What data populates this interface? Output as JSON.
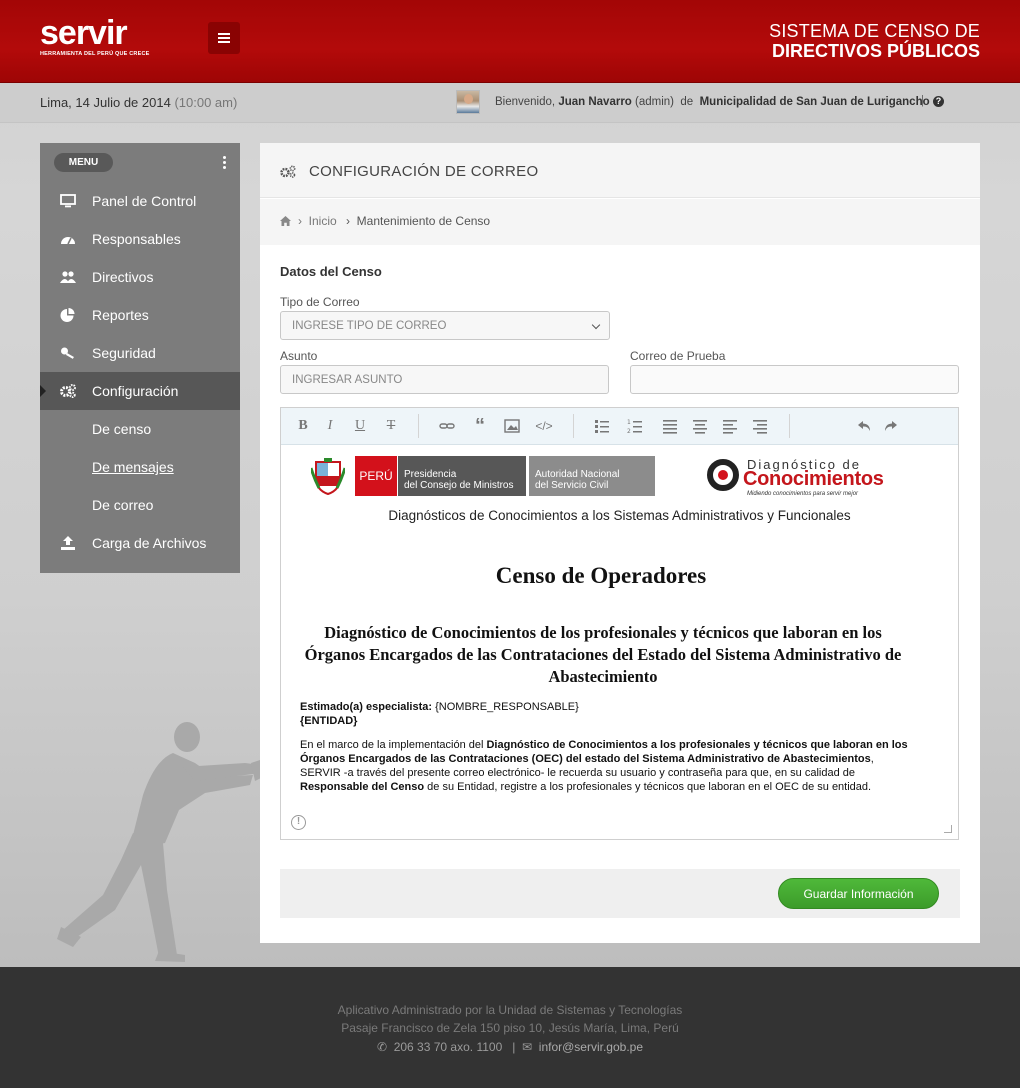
{
  "header": {
    "logo_text": "servir",
    "logo_tagline": "HERRAMIENTA DEL PERÚ QUE CRECE",
    "title_line1": "SISTEMA DE CENSO  DE",
    "title_line2": "DIRECTIVOS PÚBLICOS"
  },
  "infobar": {
    "date": "Lima, 14 Julio de 2014",
    "time": "(10:00 am)",
    "welcome_prefix": "Bienvenido,",
    "user_name": "Juan Navarro",
    "user_role": "(admin)",
    "of": "de",
    "institution": "Municipalidad de San Juan de Lurigancho",
    "separator": "|",
    "help": "?"
  },
  "sidebar": {
    "menu_label": "MENU",
    "items": [
      {
        "label": "Panel de Control",
        "icon": "monitor-icon"
      },
      {
        "label": "Responsables",
        "icon": "dashboard-icon"
      },
      {
        "label": "Directivos",
        "icon": "users-icon"
      },
      {
        "label": "Reportes",
        "icon": "pie-chart-icon"
      },
      {
        "label": "Seguridad",
        "icon": "key-icon"
      },
      {
        "label": "Configuración",
        "icon": "cogs-icon"
      }
    ],
    "subitems": [
      {
        "label": "De censo"
      },
      {
        "label": "De mensajes"
      },
      {
        "label": "De correo"
      }
    ],
    "upload": {
      "label": "Carga de Archivos",
      "icon": "upload-icon"
    }
  },
  "panel": {
    "title": "CONFIGURACIÓN DE CORREO",
    "breadcrumb": [
      "Inicio",
      "Mantenimiento de Censo"
    ],
    "section_title": "Datos del Censo",
    "tipo_label": "Tipo de Correo",
    "tipo_placeholder": "INGRESE TIPO DE CORREO",
    "asunto_label": "Asunto",
    "asunto_placeholder": "INGRESAR ASUNTO",
    "prueba_label": "Correo de Prueba",
    "prueba_value": "",
    "save_button": "Guardar Información"
  },
  "editor": {
    "toolbar": [
      "bold-icon",
      "italic-icon",
      "underline-icon",
      "strikethrough-icon",
      "link-icon",
      "quote-icon",
      "image-icon",
      "code-icon",
      "bullet-list-icon",
      "numbered-list-icon",
      "align-justify-icon",
      "align-center-icon",
      "align-left-icon",
      "align-right-icon",
      "undo-icon",
      "redo-icon"
    ],
    "logos": {
      "peru": "PERÚ",
      "pcm_line1": "Presidencia",
      "pcm_line2": "del Consejo de Ministros",
      "ansc_line1": "Autoridad Nacional",
      "ansc_line2": "del Servicio Civil",
      "diag_line1": "Diagnóstico de",
      "diag_line2": "Conocimientos",
      "diag_line3": "Midiendo conocimientos para servir mejor"
    },
    "subtitle": "Diagnósticos de Conocimientos a los Sistemas Administrativos y Funcionales",
    "title": "Censo de Operadores",
    "heading": "Diagnóstico de Conocimientos de los profesionales y técnicos que laboran en los Órganos Encargados de las Contrataciones del Estado del Sistema Administrativo de Abastecimiento",
    "greeting_label": "Estimado(a) especialista:",
    "greeting_var": "{NOMBRE_RESPONSABLE}",
    "entity_var": "{ENTIDAD}",
    "body_p1": "En el marco de la implementación del ",
    "body_b1": "Diagnóstico de Conocimientos a los profesionales y técnicos que laboran en los Órganos Encargados de las Contrataciones (OEC) del estado del Sistema Administrativo de Abastecimientos",
    "body_p2": ", SERVIR -a través del presente correo electrónico- le recuerda su usuario y contraseña para que, en su calidad de ",
    "body_b2": "Responsable del Censo",
    "body_p3": " de su Entidad, registre a los profesionales y técnicos que laboran en el OEC de su entidad."
  },
  "footer": {
    "line1": "Aplicativo Administrado por la Unidad de Sistemas y Tecnologías",
    "line2": "Pasaje Francisco de Zela 150 piso 10, Jesús María, Lima, Perú",
    "phone": "206 33 70 axo. 1100",
    "email": "infor@servir.gob.pe"
  }
}
